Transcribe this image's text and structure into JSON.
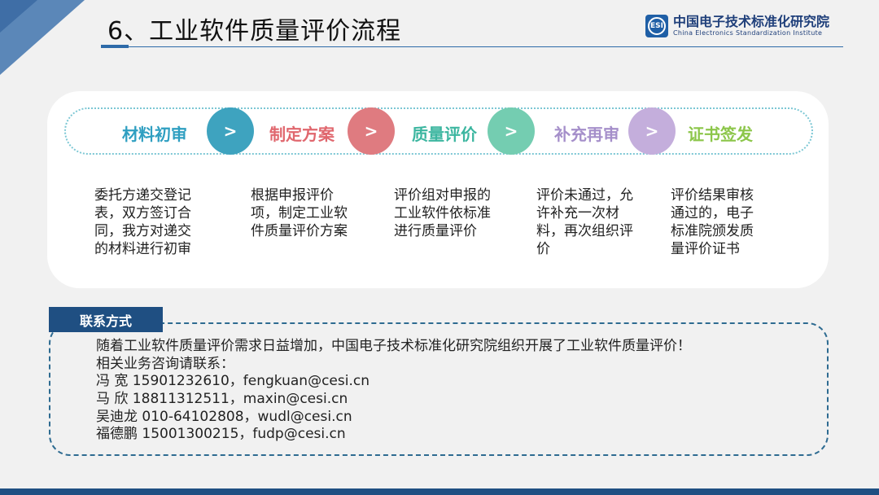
{
  "colors": {
    "accent_blue": "#2d6aa8",
    "dark_blue": "#1f4f82",
    "step1": "#2f9fc1",
    "step2": "#e0676e",
    "step3": "#3cb6a0",
    "step4": "#a58fca",
    "step5": "#8cc64a"
  },
  "header": {
    "title": "6、工业软件质量评价流程"
  },
  "logo": {
    "mark": "ESI",
    "cn_name": "中国电子技术标准化研究院",
    "en_name": "China Electronics Standardization Institute"
  },
  "process": {
    "arrow_glyph": ">",
    "steps": [
      {
        "label": "材料初审",
        "description": "委托方递交登记表，双方签订合同，我方对递交的材料进行初审"
      },
      {
        "label": "制定方案",
        "description": "根据申报评价项，制定工业软件质量评价方案"
      },
      {
        "label": "质量评价",
        "description": "评价组对申报的工业软件依标准进行质量评价"
      },
      {
        "label": "补充再审",
        "description": "评价未通过，允许补充一次材料，再次组织评价"
      },
      {
        "label": "证书签发",
        "description": "评价结果审核通过的，电子标准院颁发质量评价证书"
      }
    ]
  },
  "contact": {
    "header": "联系方式",
    "intro": "随着工业软件质量评价需求日益增加，中国电子技术标准化研究院组织开展了工业软件质量评价！",
    "prompt": "相关业务咨询请联系：",
    "people": [
      "冯  宽 15901232610，fengkuan@cesi.cn",
      "马  欣 18811312511，maxin@cesi.cn",
      "吴迪龙 010-64102808，wudl@cesi.cn",
      "福德鹏 15001300215，fudp@cesi.cn"
    ]
  }
}
